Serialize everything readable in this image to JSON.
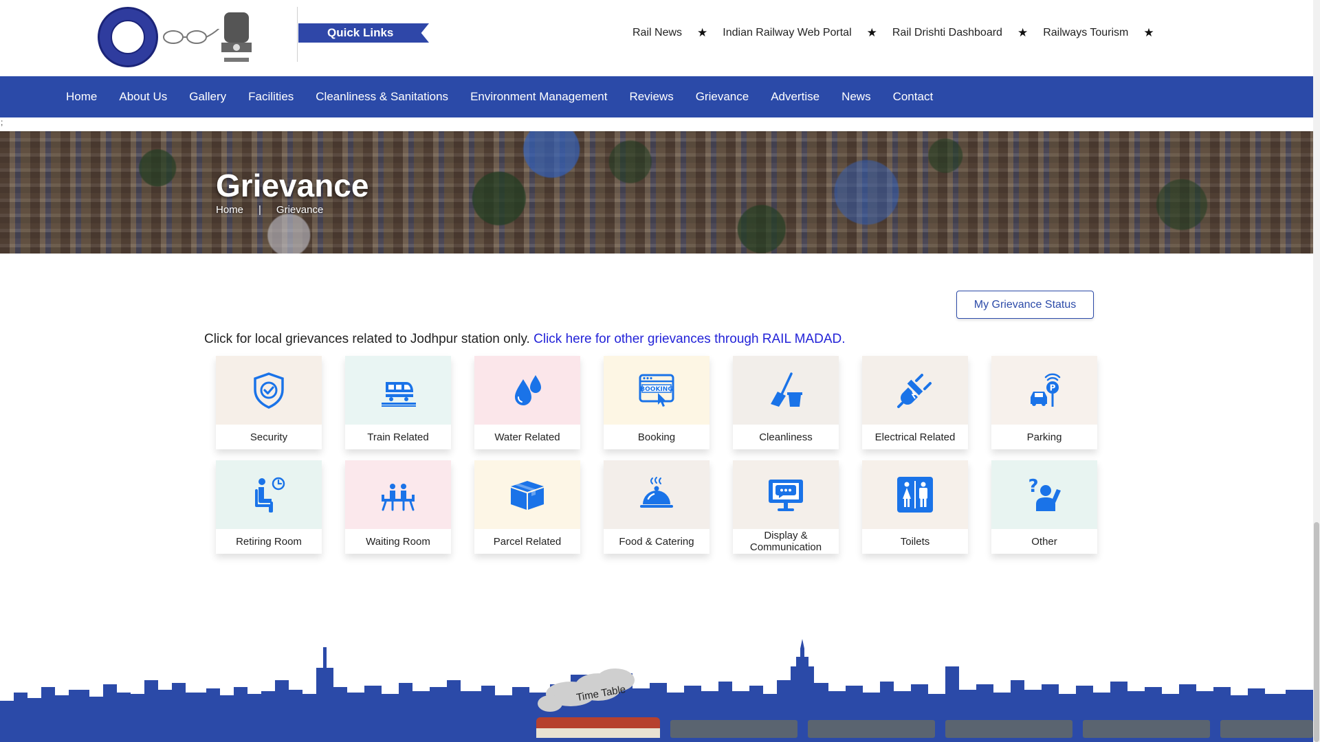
{
  "header": {
    "quick_links_label": "Quick Links",
    "top_links": [
      "Rail News",
      "Indian Railway Web Portal",
      "Rail Drishti Dashboard",
      "Railways Tourism"
    ]
  },
  "nav": {
    "items": [
      "Home",
      "About Us",
      "Gallery",
      "Facilities",
      "Cleanliness & Sanitations",
      "Environment Management",
      "Reviews",
      "Grievance",
      "Advertise",
      "News",
      "Contact"
    ]
  },
  "stray_text": ";",
  "banner": {
    "title": "Grievance",
    "breadcrumb_home": "Home",
    "breadcrumb_sep": "|",
    "breadcrumb_current": "Grievance"
  },
  "main": {
    "status_button": "My Grievance Status",
    "notice_text": "Click for local grievances related to Jodhpur station only.",
    "notice_link": "Click here for other grievances through RAIL MADAD."
  },
  "categories": [
    {
      "label": "Security",
      "icon": "shield-check-icon",
      "bg": "#f6efe8"
    },
    {
      "label": "Train Related",
      "icon": "train-icon",
      "bg": "#e9f5f3"
    },
    {
      "label": "Water Related",
      "icon": "water-drops-icon",
      "bg": "#fbe6ea"
    },
    {
      "label": "Booking",
      "icon": "booking-icon",
      "bg": "#fdf6e4"
    },
    {
      "label": "Cleanliness",
      "icon": "broom-icon",
      "bg": "#f2eeea"
    },
    {
      "label": "Electrical Related",
      "icon": "plug-icon",
      "bg": "#f4efea"
    },
    {
      "label": "Parking",
      "icon": "parking-icon",
      "bg": "#f7f1ec"
    },
    {
      "label": "Retiring Room",
      "icon": "resting-person-icon",
      "bg": "#e8f4f1"
    },
    {
      "label": "Waiting Room",
      "icon": "waiting-room-icon",
      "bg": "#fbe8ec"
    },
    {
      "label": "Parcel Related",
      "icon": "parcel-box-icon",
      "bg": "#fdf6e6"
    },
    {
      "label": "Food & Catering",
      "icon": "food-cloche-icon",
      "bg": "#f3eeea"
    },
    {
      "label": "Display & Communication",
      "icon": "display-monitor-icon",
      "bg": "#f4efea"
    },
    {
      "label": "Toilets",
      "icon": "toilet-icon",
      "bg": "#f6f0ea"
    },
    {
      "label": "Other",
      "icon": "question-person-icon",
      "bg": "#e8f4f1"
    }
  ],
  "footer": {
    "timetable_label": "Time Table"
  },
  "colors": {
    "brand_blue": "#2b4aa8",
    "icon_blue": "#1a73e8",
    "link_blue": "#2323d8"
  }
}
